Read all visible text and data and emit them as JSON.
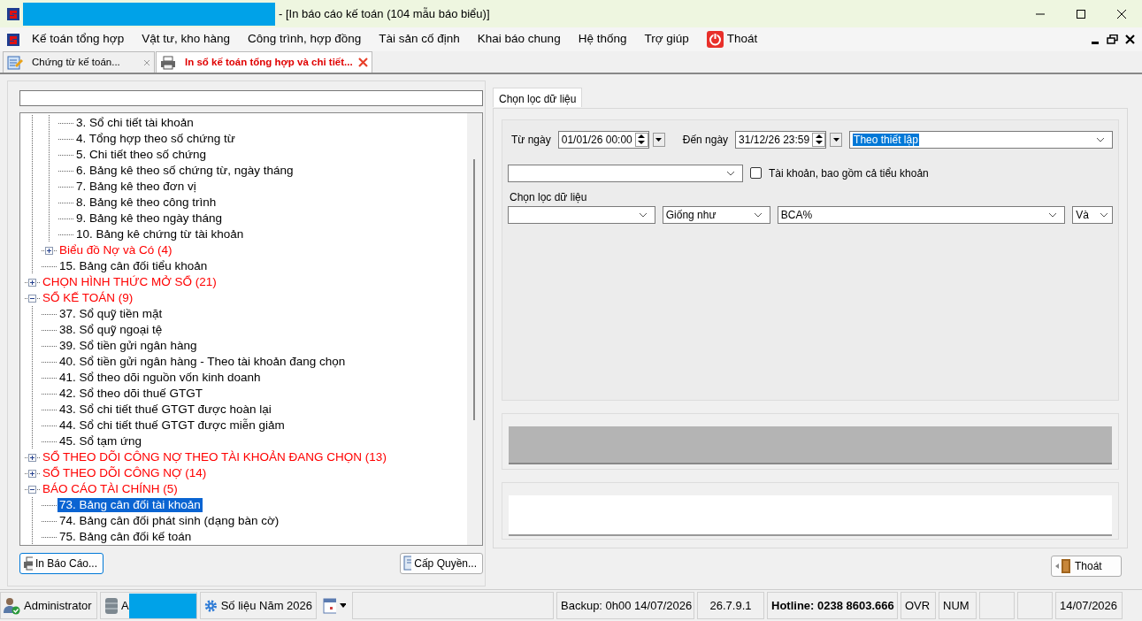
{
  "window": {
    "title": "- [In báo cáo kế toán (104 mẫu báo biểu)]"
  },
  "menu": [
    {
      "label": "Kế toán tổng hợp"
    },
    {
      "label": "Vật tư, kho hàng"
    },
    {
      "label": "Công trình, hợp đồng"
    },
    {
      "label": "Tài sản cố định"
    },
    {
      "label": "Khai báo chung"
    },
    {
      "label": "Hệ thống"
    },
    {
      "label": "Trợ giúp"
    },
    {
      "label": "Thoát",
      "kind": "exit"
    }
  ],
  "doc_tabs": [
    {
      "label": "Chứng từ kế toán...",
      "selected": false,
      "kind": "voucher"
    },
    {
      "label": "In sổ kế toán tổng hợp và chi tiết...",
      "selected": true,
      "kind": "print"
    }
  ],
  "tree": {
    "items": [
      {
        "children": [
          {
            "children": [
              {
                "label": "3. Sổ chi tiết tài khoản",
                "selected": false
              },
              {
                "label": "4. Tổng hợp theo số chứng từ",
                "selected": false
              },
              {
                "label": "5. Chi tiết theo số chứng",
                "selected": false
              },
              {
                "label": "6. Bảng kê theo số chứng từ, ngày tháng",
                "selected": false
              },
              {
                "label": "7. Bảng kê theo đơn vị",
                "selected": false
              },
              {
                "label": "8. Bảng kê theo công trình",
                "selected": false
              },
              {
                "label": "9. Bảng kê theo ngày tháng",
                "selected": false
              },
              {
                "label": "10. Bảng kê chứng từ tài khoản",
                "selected": false
              }
            ]
          },
          {
            "label": "Biểu đồ Nợ và Có (4)",
            "kind": "group",
            "expanded": false,
            "selected": false
          },
          {
            "label": "15. Bảng cân đối tiểu khoản",
            "selected": false
          }
        ]
      },
      {
        "label": "CHỌN HÌNH THỨC MỞ SỔ (21)",
        "kind": "group",
        "expanded": false,
        "selected": false
      },
      {
        "label": "SỔ KẾ TOÁN (9)",
        "kind": "group",
        "expanded": true,
        "selected": false,
        "children": [
          {
            "label": "37. Sổ quỹ tiền mặt",
            "selected": false
          },
          {
            "label": "38. Sổ quỹ ngoại tệ",
            "selected": false
          },
          {
            "label": "39. Sổ tiền gửi ngân hàng",
            "selected": false
          },
          {
            "label": "40. Sổ tiền gửi ngân hàng - Theo tài khoản đang chọn",
            "selected": false
          },
          {
            "label": "41. Sổ theo dõi nguồn vốn kinh doanh",
            "selected": false
          },
          {
            "label": "42. Sổ theo dõi thuế GTGT",
            "selected": false
          },
          {
            "label": "43. Sổ chi tiết thuế GTGT được hoàn lại",
            "selected": false
          },
          {
            "label": "44. Sổ chi tiết thuế GTGT được miễn giảm",
            "selected": false
          },
          {
            "label": "45. Sổ tạm ứng",
            "selected": false
          }
        ]
      },
      {
        "label": "SỔ THEO DÕI CÔNG NỢ THEO TÀI KHOẢN ĐANG CHỌN (13)",
        "kind": "group",
        "expanded": false,
        "selected": false
      },
      {
        "label": "SỔ THEO DÕI CÔNG NỢ (14)",
        "kind": "group",
        "expanded": false,
        "selected": false
      },
      {
        "label": "BÁO CÁO TÀI CHÍNH (5)",
        "kind": "group",
        "expanded": true,
        "selected": false,
        "children": [
          {
            "label": "73. Bảng cân đối tài khoản",
            "selected": true
          },
          {
            "label": "74. Bảng cân đối phát sinh (dạng bàn cờ)",
            "selected": false
          },
          {
            "label": "75. Bảng cân đối kế toán",
            "selected": false
          }
        ]
      }
    ]
  },
  "left_buttons": [
    {
      "label": "In Báo Cáo...",
      "kind": "print"
    },
    {
      "label": "Cấp Quyền...",
      "kind": "permission"
    }
  ],
  "filter_tab": {
    "label": "Chọn lọc dữ liệu",
    "selected": true
  },
  "filter": {
    "from_label": "Từ ngày",
    "from_value": "01/01/26 00:00",
    "to_label": "Đến ngày",
    "to_value": "31/12/26 23:59",
    "period": "Theo thiết lập",
    "account_checkbox": {
      "label": "Tài khoản, bao gồm cả tiểu khoản",
      "checked": false
    },
    "criteria_label": "Chọn lọc dữ liệu",
    "operator": "Giống như",
    "criteria_value": "BCA%",
    "conjunction": "Và"
  },
  "exit_button": {
    "label": "Thoát"
  },
  "status_bar": {
    "user": "Administrator",
    "database": "A",
    "data_year": "Số liệu Năm 2026",
    "backup": "Backup: 0h00 14/07/2026",
    "version": "26.7.9.1",
    "hotline": "Hotline: 0238 8603.666",
    "ovr": "OVR",
    "num": "NUM",
    "date": "14/07/2026"
  }
}
